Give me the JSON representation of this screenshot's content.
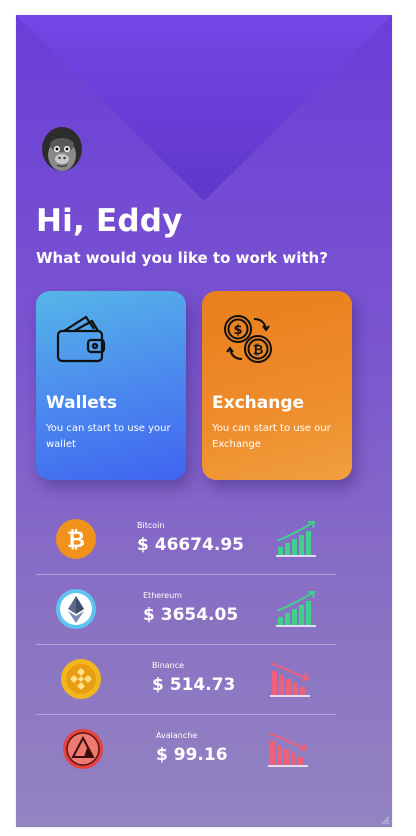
{
  "greeting": "Hi, Eddy",
  "question": "What would you like to work with?",
  "cards": [
    {
      "title": "Wallets",
      "description": "You can start to use your wallet",
      "icon": "wallet-icon"
    },
    {
      "title": "Exchange",
      "description": "You can start to use our Exchange",
      "icon": "exchange-coins-icon"
    }
  ],
  "coins": [
    {
      "name": "Bitcoin",
      "price": "$ 46674.95",
      "trend": "up",
      "icon": "bitcoin-icon"
    },
    {
      "name": "Ethereum",
      "price": "$ 3654.05",
      "trend": "up",
      "icon": "ethereum-icon"
    },
    {
      "name": "Binance",
      "price": "$ 514.73",
      "trend": "down",
      "icon": "binance-icon"
    },
    {
      "name": "Avalanche",
      "price": "$ 99.16",
      "trend": "down",
      "icon": "avalanche-icon"
    }
  ],
  "colors": {
    "background_top": "#6a3ed8",
    "background_bottom": "#9384c2",
    "wallets_card": "#4b87ee",
    "exchange_card": "#ee8c2b",
    "trend_up": "#3fd08a",
    "trend_down": "#f0607a"
  }
}
